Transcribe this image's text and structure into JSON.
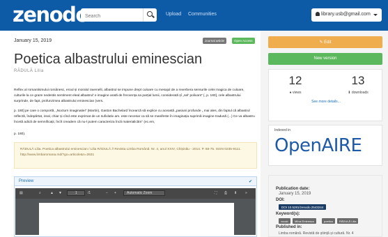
{
  "header": {
    "logo": "zenodo",
    "search_placeholder": "Search",
    "nav": [
      "Upload",
      "Communities"
    ],
    "user_email": "library.usb@gmail.com"
  },
  "record": {
    "publication_date": "January 15, 2019",
    "badges": [
      {
        "label": "Journal article",
        "color": "#777777"
      },
      {
        "label": "Open Access",
        "color": "#5cb85c"
      }
    ],
    "title": "Poetica albastrului eminescian",
    "author": "RĂDULĂ Lilia",
    "paragraphs": [
      "Reflex al romantismului românesc, eroul și moralul ravenelli, albastrul se impune drept culoare cu mesajul de a reverbera sensurile celei magica de culoare, culturile la ce graze nedestis sentiment eleal albastrul' e imagine arată de frecvența sa parțial lumii, considerată șî „sel' polivant” (, p. 180], cele albastrului surprinde, de fapt, profunzimea albastrului eminescian (vers.",
      "p. 180] pe care o comportă, „Nocturn imaginatiei” (Martin), Gaston Bachelard încearcă să explice cu această „pasiuni profunde „ mai ales, din faptul că albastrul reflectă, îndepărtat, ireal, chiar și cînd este exprimat de un sufixlativ am. este necesar ca să se manifeste în imaginația suprimă imagine tradusă (...) Ce va albastru încetă adică de semnificații, încît creadem că nu-l putem caracteriza încă materialicăm” (ec.em,",
      "p. 180)."
    ],
    "citation": "RĂDULĂ Lilia. Poetica albastrului eminescian / Lilia RĂDULĂ // Revista Limba Română. Nr. 4, anul XXIV, Chișinău - 2014. P. 68-75. ISSN 0235-9111. http://www.limbaromana.md/?go=articole&n=2631",
    "preview": {
      "label": "Preview",
      "check": "✔",
      "page_label": "/1",
      "page_current": "1",
      "zoom_label": "Automatic Zoom"
    }
  },
  "sidebar": {
    "edit_label": "✎ Edit",
    "new_version_label": "New version",
    "views": {
      "count": "12",
      "label": "views"
    },
    "downloads": {
      "count": "13",
      "label": "downloads"
    },
    "see_more": "See more details...",
    "indexed_in": "Indexed in",
    "indexed_logo": "OpenAIRE",
    "publication_date_label": "Publication date:",
    "publication_date_value": "January 15, 2019",
    "doi_label": "DOI:",
    "doi_value": "DOI 10.5281/zenodo.2543244",
    "keywords_label": "Keyword(s):",
    "keywords": [
      "vocab",
      "Mihai Eminescu",
      "poetica",
      "RĂDULĂ Lilia"
    ],
    "published_in_label": "Published in:",
    "published_in_value": "Limba română. Revistă de știință și cultură. Nr. 4"
  }
}
